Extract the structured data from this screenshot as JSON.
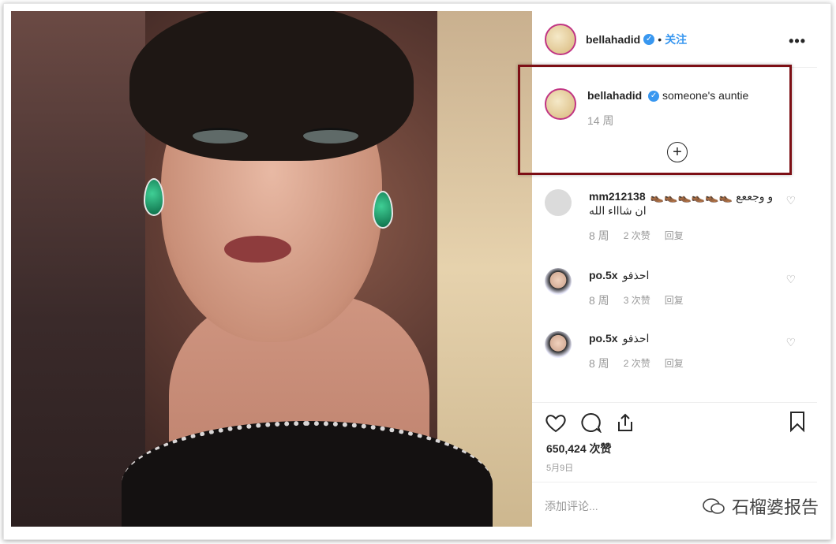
{
  "post_header": {
    "username": "bellahadid",
    "verified_mark": "✓",
    "separator": "•",
    "follow": "关注",
    "more": "•••"
  },
  "caption": {
    "username": "bellahadid",
    "text": "someone's auntie",
    "time": "14 周",
    "add_icon": "plus-circle-icon"
  },
  "comments": [
    {
      "username": "mm212138",
      "text": "👞👞👞👞👞👞 و وجععع ان شاااء الله",
      "time": "8 周",
      "likes": "2 次赞",
      "reply": "回复"
    },
    {
      "username": "po.5x",
      "text": "احذفو",
      "time": "8 周",
      "likes": "3 次赞",
      "reply": "回复"
    },
    {
      "username": "po.5x",
      "text": "احذفو",
      "time": "8 周",
      "likes": "2 次赞",
      "reply": "回复"
    }
  ],
  "actions": {
    "likes": "650,424 次赞",
    "date": "5月9日",
    "add_comment_placeholder": "添加评论..."
  },
  "watermark": {
    "text": "石榴婆报告"
  },
  "colors": {
    "accent": "#3897f0",
    "highlight_border": "#7d0f15"
  }
}
